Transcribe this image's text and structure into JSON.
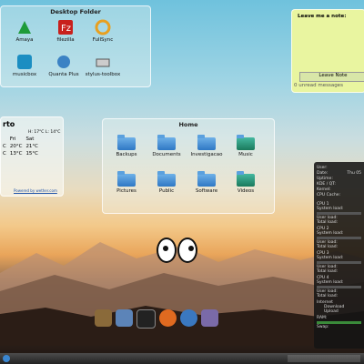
{
  "desktop_folder": {
    "title": "Desktop Folder",
    "items": [
      "Amaya",
      "filezilla",
      "FullSync",
      "musicbox",
      "Quanta Plus",
      "stylus-toolbox"
    ]
  },
  "note": {
    "title": "Leave me a note:",
    "button": "Leave Note",
    "status": "0 unread messages"
  },
  "weather": {
    "city": "rto",
    "hilo": "H: 17°C L: 14°C",
    "days": [
      "Fri",
      "Sat"
    ],
    "rows": [
      [
        "C",
        "20°C",
        "21°C"
      ],
      [
        "C",
        "13°C",
        "15°C"
      ]
    ],
    "powered": "Powered by wether.com"
  },
  "home": {
    "title": "Home",
    "items": [
      "Backups",
      "Documents",
      "Investigacao",
      "Music",
      "Pictures",
      "Public",
      "Software",
      "Videos"
    ]
  },
  "sysmon": {
    "header": [
      "User:",
      "Date:",
      "Uptime:",
      "KDE / QT:",
      "Kernel:",
      "CPU Cache:"
    ],
    "date": "Thu 05",
    "cpus": [
      "CPU 1",
      "CPU 2",
      "CPU 3",
      "CPU 4"
    ],
    "cpu_lines": [
      "System load:",
      "User load:",
      "Total load:"
    ],
    "internet": "Internet",
    "download": "Download",
    "upload": "Upload",
    "ram": "RAM:",
    "swap": "Swap:"
  }
}
